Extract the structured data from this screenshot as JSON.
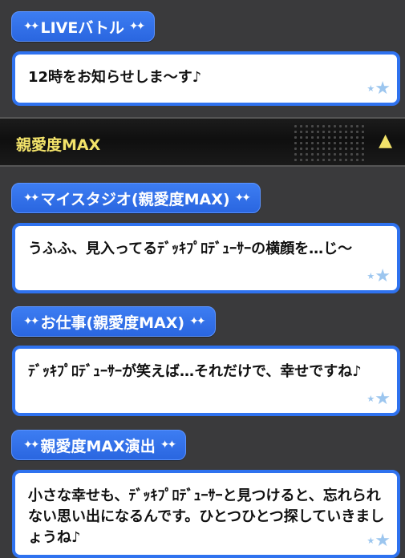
{
  "spark": "★",
  "blocks": [
    {
      "tag": "LIVEバトル",
      "text": "12時をお知らせしま～す♪"
    },
    {
      "tag": "マイスタジオ(親愛度MAX)",
      "text": "うふふ、見入ってるﾃﾞｯｷﾌﾟﾛﾃﾞｭｰｻｰの横顔を…じ～"
    },
    {
      "tag": "お仕事(親愛度MAX)",
      "text": "ﾃﾞｯｷﾌﾟﾛﾃﾞｭｰｻｰが笑えば…それだけで、幸せですね♪"
    },
    {
      "tag": "親愛度MAX演出",
      "text": "小さな幸せも、ﾃﾞｯｷﾌﾟﾛﾃﾞｭｰｻｰと見つけると、忘れられない思い出になるんです。ひとつひとつ探していきましょうね♪"
    }
  ],
  "section": {
    "title": "親愛度MAX",
    "toggle_icon": "collapse-triangle-icon"
  },
  "colors": {
    "tag_blue": "#2f72ef",
    "section_title": "#f3e36a",
    "background": "#3a3a3c"
  }
}
